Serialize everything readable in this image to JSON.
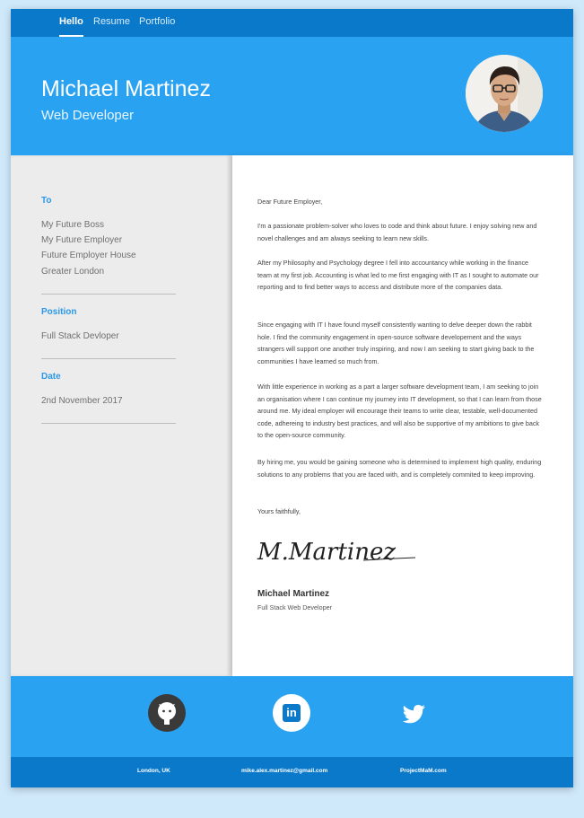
{
  "nav": {
    "items": [
      {
        "label": "Hello",
        "active": true
      },
      {
        "label": "Resume",
        "active": false
      },
      {
        "label": "Portfolio",
        "active": false
      }
    ]
  },
  "header": {
    "name": "Michael Martinez",
    "title": "Web Developer"
  },
  "sidebar": {
    "to_heading": "To",
    "to_lines": [
      "My Future Boss",
      "My Future Employer",
      "Future Employer House",
      "Greater London"
    ],
    "position_heading": "Position",
    "position_value": "Full Stack Devloper",
    "date_heading": "Date",
    "date_value": "2nd November 2017"
  },
  "letter": {
    "salutation": "Dear Future Employer,",
    "paragraphs": [
      "I'm a passionate problem-solver who loves to code and think about future. I enjoy solving new and novel challenges and am always seeking to learn new skills.",
      "After my Philosophy and Psychology degree I fell into accountancy while working in the finance team at my first job. Accounting is what led to me first engaging with IT as I sought to automate our reporting and to find better ways to access and distribute more of the companies data.",
      "Since engaging with IT I have found myself consistently wanting to delve deeper down the rabbit hole. I find the community engagement in open-source software developement and the ways strangers will support one another truly inspiring, and now I am seeking to start giving back to the communities I have learned so much from.",
      "With little experience in working as a part a larger software development team, I am seeking to join an organisation where I can continue my journey into IT development, so that I can learn from those around me. My ideal employer will encourage their teams to write clear, testable, well-documented code, adhereing to industry best practices, and will also be supportive of my ambitions to give back to the open-source community.",
      "By hiring me, you would be gaining someone who is determined to implement high quality, enduring solutions to any problems that you are faced with, and is completely commited to keep improving."
    ],
    "closing": "Yours faithfully,",
    "signature_text": "M.Martinez",
    "sign_name": "Michael Martinez",
    "sign_role": "Full Stack Web Developer"
  },
  "social": {
    "icons": [
      "github-icon",
      "linkedin-icon",
      "twitter-icon"
    ],
    "linkedin_glyph": "in"
  },
  "footer": {
    "location": "London, UK",
    "email": "mike.alex.martinez@gmail.com",
    "website": "ProjectMaM.com"
  },
  "colors": {
    "primary": "#2aa2f2",
    "primary_dark": "#0a79c9",
    "sidebar_bg": "#ececec",
    "heading_blue": "#2a98e8"
  }
}
